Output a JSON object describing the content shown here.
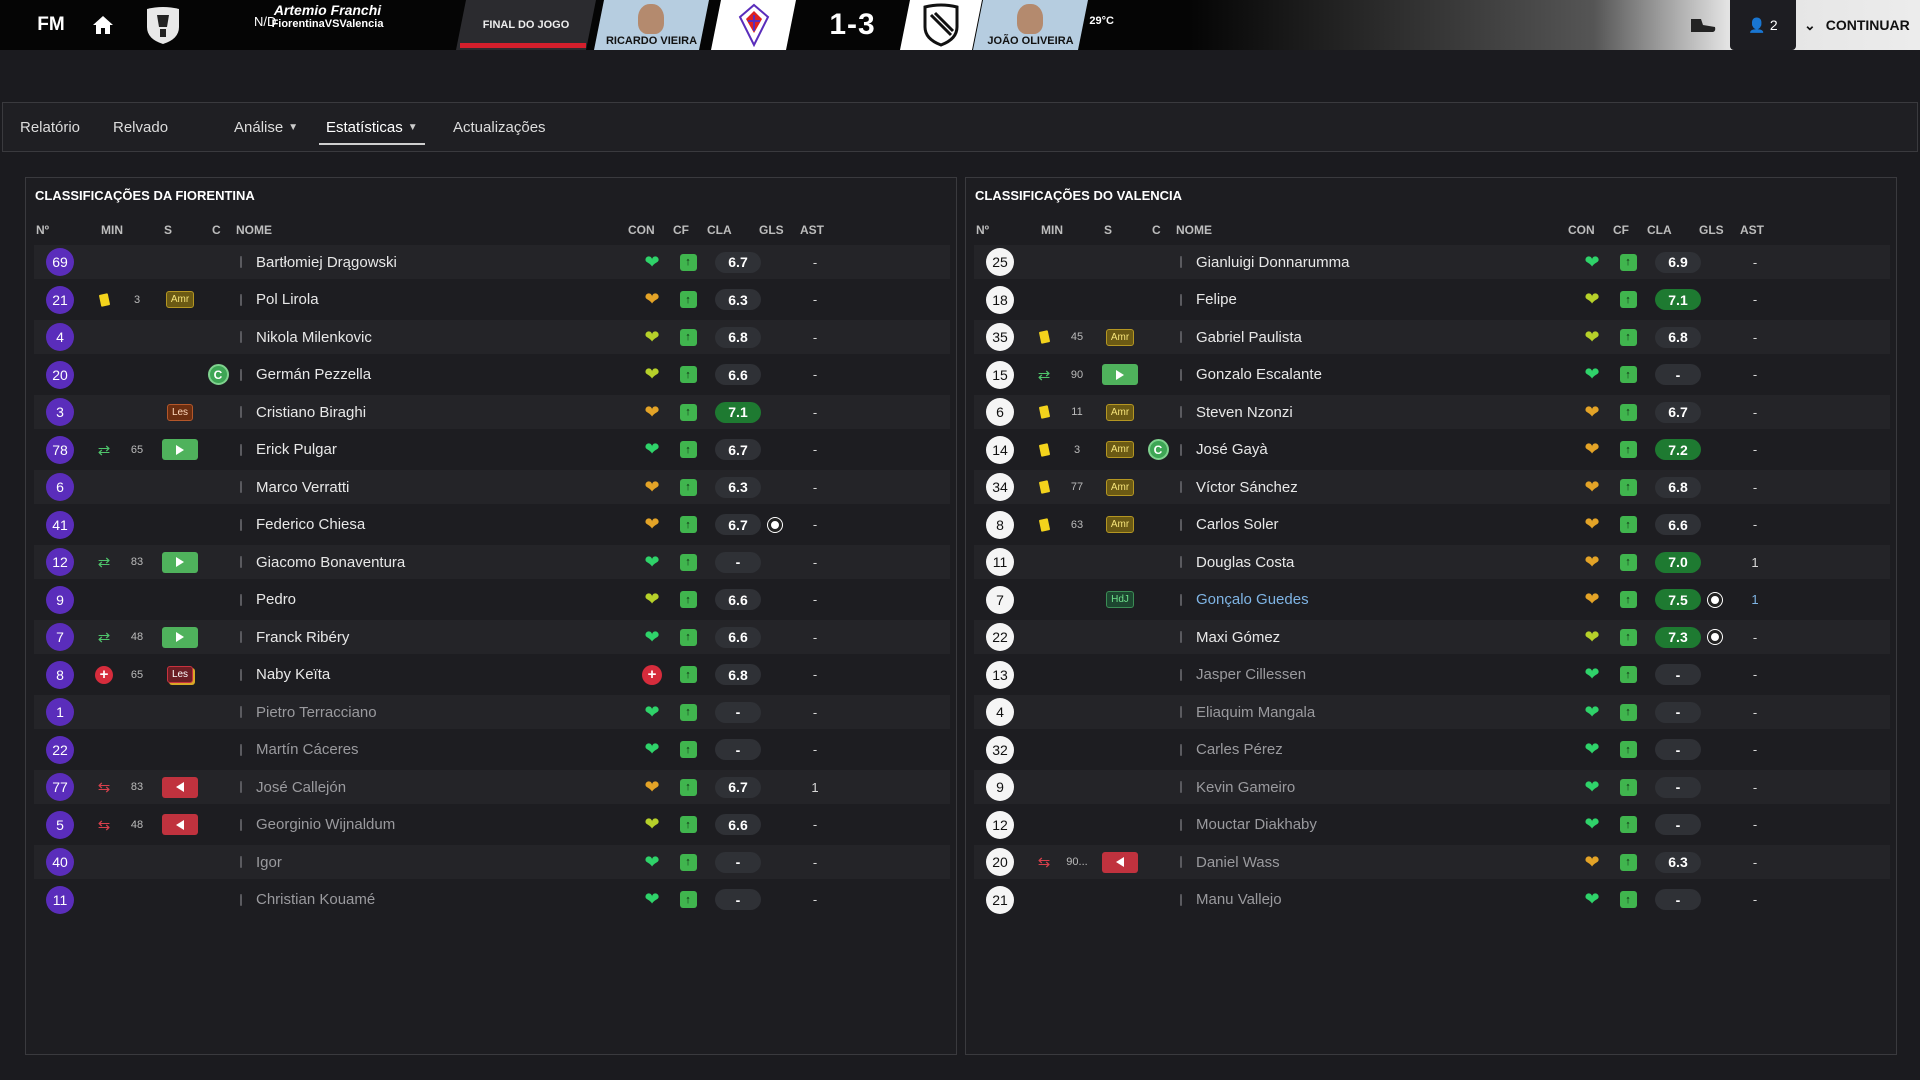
{
  "app": {
    "logo": "FM"
  },
  "header": {
    "stadium": "Artemio Franchi",
    "matchup": "FiorentinaVSValencia",
    "attendance": "N/D",
    "temperature": "29°C",
    "status": "FINAL DO JOGO",
    "home_manager": "RICARDO VIEIRA",
    "away_manager": "JOÃO OLIVEIRA",
    "score": "1-3",
    "notifications": "2",
    "continue_label": "CONTINUAR"
  },
  "tabs": [
    "Relatório",
    "Relvado",
    "Análise",
    "Estatísticas",
    "Actualizações"
  ],
  "columns": {
    "no": "Nº",
    "min": "MIN",
    "s": "S",
    "c": "C",
    "name": "NOME",
    "con": "CON",
    "cf": "CF",
    "cla": "CLA",
    "gls": "GLS",
    "ast": "AST"
  },
  "home": {
    "title": "CLASSIFICAÇÕES DA FIORENTINA",
    "players": [
      {
        "no": "69",
        "name": "Bartłomiej Drągowski",
        "con": "green",
        "rating": "6.7",
        "ast": "-"
      },
      {
        "no": "21",
        "event": "yellow",
        "min": "3",
        "badge": "Amr",
        "badge_type": "amr",
        "name": "Pol Lirola",
        "con": "gold",
        "rating": "6.3",
        "ast": "-"
      },
      {
        "no": "4",
        "name": "Nikola Milenkovic",
        "con": "olive",
        "rating": "6.8",
        "ast": "-"
      },
      {
        "no": "20",
        "captain": "C",
        "name": "Germán Pezzella",
        "con": "olive",
        "rating": "6.6",
        "ast": "-"
      },
      {
        "no": "3",
        "badge": "Les",
        "badge_type": "les",
        "name": "Cristiano Biraghi",
        "con": "gold",
        "rating": "7.1",
        "rating_hi": true,
        "ast": "-"
      },
      {
        "no": "78",
        "event": "sub-in",
        "min": "65",
        "badge_type": "in",
        "name": "Erick Pulgar",
        "con": "green",
        "rating": "6.7",
        "ast": "-"
      },
      {
        "no": "6",
        "name": "Marco Verratti",
        "con": "gold",
        "rating": "6.3",
        "ast": "-"
      },
      {
        "no": "41",
        "name": "Federico Chiesa",
        "con": "gold",
        "rating": "6.7",
        "goal": true,
        "ast": "-"
      },
      {
        "no": "12",
        "event": "sub-in",
        "min": "83",
        "badge_type": "in",
        "name": "Giacomo Bonaventura",
        "con": "green",
        "rating": "-",
        "ast": "-"
      },
      {
        "no": "9",
        "name": "Pedro",
        "con": "olive",
        "rating": "6.6",
        "ast": "-"
      },
      {
        "no": "7",
        "event": "sub-in",
        "min": "48",
        "badge_type": "in",
        "name": "Franck Ribéry",
        "con": "green",
        "rating": "6.6",
        "ast": "-"
      },
      {
        "no": "8",
        "event": "injury",
        "min": "65",
        "badge": "Les",
        "badge_type": "les2",
        "name": "Naby Keïta",
        "con": "red",
        "rating": "6.8",
        "ast": "-"
      },
      {
        "no": "1",
        "name": "Pietro Terracciano",
        "con": "green",
        "rating": "-",
        "ast": "-",
        "sub": true
      },
      {
        "no": "22",
        "name": "Martín Cáceres",
        "con": "green",
        "rating": "-",
        "ast": "-",
        "sub": true
      },
      {
        "no": "77",
        "event": "sub-out",
        "min": "83",
        "badge_type": "out",
        "name": "José Callejón",
        "con": "gold",
        "rating": "6.7",
        "ast": "1",
        "sub": true
      },
      {
        "no": "5",
        "event": "sub-out",
        "min": "48",
        "badge_type": "out",
        "name": "Georginio Wijnaldum",
        "con": "olive",
        "rating": "6.6",
        "ast": "-",
        "sub": true
      },
      {
        "no": "40",
        "name": "Igor",
        "con": "green",
        "rating": "-",
        "ast": "-",
        "sub": true
      },
      {
        "no": "11",
        "name": "Christian Kouamé",
        "con": "green",
        "rating": "-",
        "ast": "-",
        "sub": true
      }
    ]
  },
  "away": {
    "title": "CLASSIFICAÇÕES DO VALENCIA",
    "players": [
      {
        "no": "25",
        "name": "Gianluigi Donnarumma",
        "con": "green",
        "rating": "6.9",
        "ast": "-"
      },
      {
        "no": "18",
        "name": "Felipe",
        "con": "olive",
        "rating": "7.1",
        "rating_hi": true,
        "ast": "-"
      },
      {
        "no": "35",
        "event": "yellow",
        "min": "45",
        "badge": "Amr",
        "badge_type": "amr",
        "name": "Gabriel Paulista",
        "con": "olive",
        "rating": "6.8",
        "ast": "-"
      },
      {
        "no": "15",
        "event": "sub-in",
        "min": "90",
        "badge_type": "in",
        "name": "Gonzalo Escalante",
        "con": "green",
        "rating": "-",
        "ast": "-"
      },
      {
        "no": "6",
        "event": "yellow",
        "min": "11",
        "badge": "Amr",
        "badge_type": "amr",
        "name": "Steven Nzonzi",
        "con": "gold",
        "rating": "6.7",
        "ast": "-"
      },
      {
        "no": "14",
        "event": "yellow",
        "min": "3",
        "badge": "Amr",
        "badge_type": "amr",
        "captain": "C",
        "name": "José Gayà",
        "con": "gold",
        "rating": "7.2",
        "rating_hi": true,
        "ast": "-"
      },
      {
        "no": "34",
        "event": "yellow",
        "min": "77",
        "badge": "Amr",
        "badge_type": "amr",
        "name": "Víctor Sánchez",
        "con": "gold",
        "rating": "6.8",
        "ast": "-"
      },
      {
        "no": "8",
        "event": "yellow",
        "min": "63",
        "badge": "Amr",
        "badge_type": "amr",
        "name": "Carlos Soler",
        "con": "gold",
        "rating": "6.6",
        "ast": "-"
      },
      {
        "no": "11",
        "name": "Douglas Costa",
        "con": "gold",
        "rating": "7.0",
        "rating_hi": true,
        "ast": "1"
      },
      {
        "no": "7",
        "badge": "HdJ",
        "badge_type": "hdj",
        "name": "Gonçalo Guedes",
        "name_link": true,
        "con": "gold",
        "rating": "7.5",
        "rating_hi": true,
        "goal": true,
        "ast": "1",
        "ast_blue": true
      },
      {
        "no": "22",
        "name": "Maxi Gómez",
        "con": "olive",
        "rating": "7.3",
        "rating_hi": true,
        "goal": true,
        "ast": "-"
      },
      {
        "no": "13",
        "name": "Jasper Cillessen",
        "con": "green",
        "rating": "-",
        "ast": "-",
        "sub": true
      },
      {
        "no": "4",
        "name": "Eliaquim Mangala",
        "con": "green",
        "rating": "-",
        "ast": "-",
        "sub": true
      },
      {
        "no": "32",
        "name": "Carles Pérez",
        "con": "green",
        "rating": "-",
        "ast": "-",
        "sub": true
      },
      {
        "no": "9",
        "name": "Kevin Gameiro",
        "con": "green",
        "rating": "-",
        "ast": "-",
        "sub": true
      },
      {
        "no": "12",
        "name": "Mouctar Diakhaby",
        "con": "green",
        "rating": "-",
        "ast": "-",
        "sub": true
      },
      {
        "no": "20",
        "event": "sub-out",
        "min": "90...",
        "badge_type": "out",
        "name": "Daniel Wass",
        "con": "gold",
        "rating": "6.3",
        "ast": "-",
        "sub": true
      },
      {
        "no": "21",
        "name": "Manu Vallejo",
        "con": "green",
        "rating": "-",
        "ast": "-",
        "sub": true
      }
    ]
  },
  "colors": {
    "con_green": "#2fd36a",
    "con_gold": "#e3a327",
    "con_olive": "#b6d12a",
    "con_red": "#d62c3c",
    "rating_hi": "#1e7a31",
    "home_number": "#5a2dbb"
  },
  "icons": {
    "home": "home-icon",
    "competition": "competition-logo",
    "weather": "sun-icon",
    "boot": "boot-icon",
    "user": "user-icon",
    "continue": "chevron-down-icon"
  }
}
